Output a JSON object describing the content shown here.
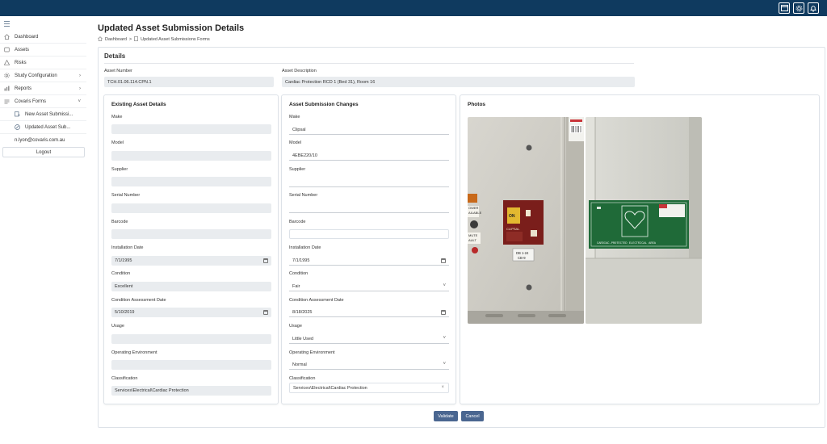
{
  "topbar": {
    "icons": [
      "window-icon",
      "gear-icon",
      "bell-icon"
    ]
  },
  "sidebar": {
    "items": [
      {
        "label": "Dashboard",
        "icon": "home-icon"
      },
      {
        "label": "Assets",
        "icon": "box-icon"
      },
      {
        "label": "Risks",
        "icon": "warning-icon"
      },
      {
        "label": "Study Configuration",
        "icon": "settings-icon"
      },
      {
        "label": "Reports",
        "icon": "chart-icon"
      },
      {
        "label": "Covaris Forms",
        "icon": "forms-icon"
      }
    ],
    "subitems": [
      {
        "label": "New Asset Submissi...",
        "icon": "new-form-icon"
      },
      {
        "label": "Updated Asset Sub...",
        "icon": "edit-form-icon"
      }
    ],
    "user_email": "n.lyon@covaris.com.au",
    "logout_label": "Logout"
  },
  "page": {
    "title": "Updated Asset Submission Details",
    "breadcrumb_home": "Dashboard",
    "breadcrumb_sep": ">",
    "breadcrumb_current": "Updated Asset Submissions Forms"
  },
  "details": {
    "title": "Details",
    "asset_number_label": "Asset Number",
    "asset_number": "TCH.01.06.114.CPN.1",
    "asset_description_label": "Asset Description",
    "asset_description": "Cardiac Protection RCD 1 (Bed 31), Room 16"
  },
  "existing": {
    "title": "Existing Asset Details",
    "fields": [
      {
        "label": "Make",
        "value": ""
      },
      {
        "label": "Model",
        "value": ""
      },
      {
        "label": "Supplier",
        "value": ""
      },
      {
        "label": "Serial Number",
        "value": ""
      },
      {
        "label": "Barcode",
        "value": ""
      },
      {
        "label": "Installation Date",
        "value": "7/1/1995"
      },
      {
        "label": "Condition",
        "value": "Excellent"
      },
      {
        "label": "Condition Assessment Date",
        "value": "5/10/2019"
      },
      {
        "label": "Usage",
        "value": ""
      },
      {
        "label": "Operating Environment",
        "value": ""
      },
      {
        "label": "Classification",
        "value": "Services\\Electrical\\Cardiac Protection"
      }
    ]
  },
  "changes": {
    "title": "Asset Submission Changes",
    "fields": [
      {
        "label": "Make",
        "value": "Clipsal"
      },
      {
        "label": "Model",
        "value": "4EBE220/10"
      },
      {
        "label": "Supplier",
        "value": ""
      },
      {
        "label": "Serial Number",
        "value": ""
      },
      {
        "label": "Barcode",
        "value": ""
      },
      {
        "label": "Installation Date",
        "value": "7/1/1995"
      },
      {
        "label": "Condition",
        "value": "Fair"
      },
      {
        "label": "Condition Assessment Date",
        "value": "8/18/2025"
      },
      {
        "label": "Usage",
        "value": "Little Used"
      },
      {
        "label": "Operating Environment",
        "value": "Normal"
      },
      {
        "label": "Classification",
        "value": "Services\\Electrical\\Cardiac Protection"
      }
    ]
  },
  "photos": {
    "title": "Photos",
    "photo1": {
      "label_on": "ON",
      "brand": "CLIPSAL",
      "db_tag_1": "DB 1-24",
      "db_tag_2": "CB-9",
      "side_text_1": "OWER",
      "side_text_2": "AILABLE",
      "side_text_3": "MUTE",
      "side_text_4": "AULT"
    },
    "photo2": {
      "sign_text": "CARDIAC-PROTECTED ELECTRICAL AREA"
    }
  },
  "actions": {
    "validate_label": "Validate",
    "cancel_label": "Cancel"
  },
  "colors": {
    "topbar": "#0f3a5f",
    "button": "#4a6690"
  }
}
